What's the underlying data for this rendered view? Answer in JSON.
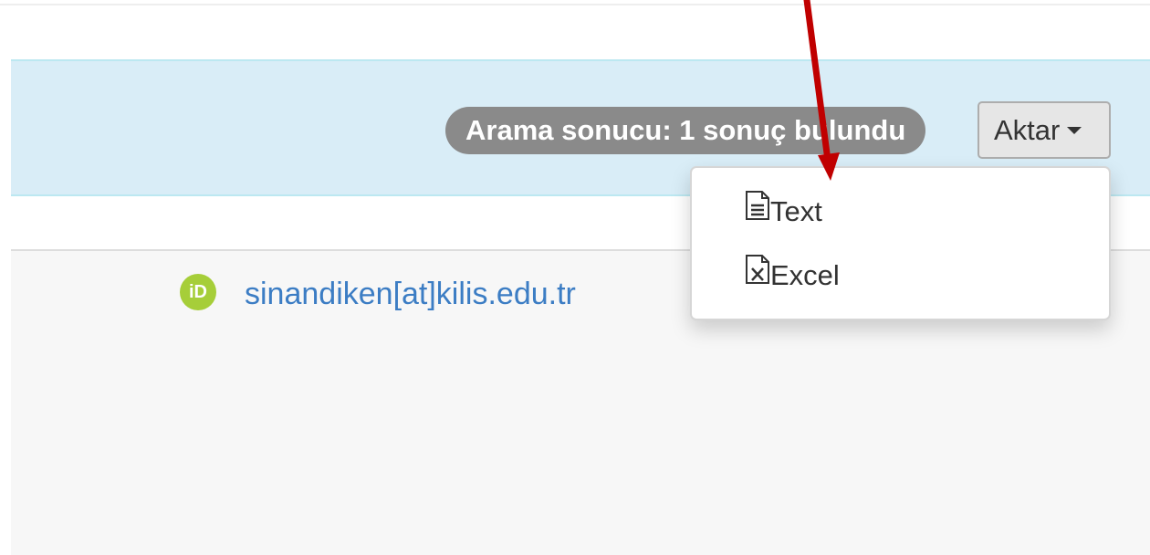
{
  "results": {
    "badge_text": "Arama sonucu: 1 sonuç bulundu",
    "export_button_label": "Aktar"
  },
  "export_menu": {
    "items": [
      {
        "label": "Text",
        "icon": "text-file-icon"
      },
      {
        "label": "Excel",
        "icon": "excel-file-icon"
      }
    ]
  },
  "person": {
    "orcid_icon_text": "iD",
    "email": "sinandiken[at]kilis.edu.tr"
  },
  "colors": {
    "info_bar": "#d9edf7",
    "badge": "#8a8a8a",
    "link": "#3c7dc4",
    "orcid": "#a6ce39",
    "annotation_arrow": "#c00000"
  }
}
